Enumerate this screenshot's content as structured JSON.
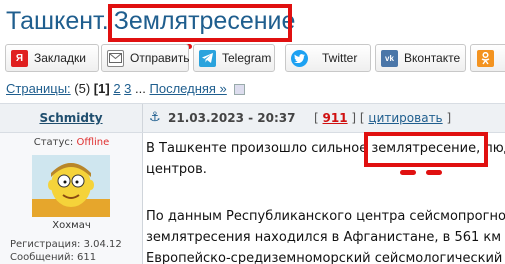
{
  "title": {
    "city": "Ташкент.",
    "topic": "Землятресение"
  },
  "share": {
    "buttons": [
      {
        "label": "Закладки",
        "icon": "yandex-icon",
        "color": "#e02020"
      },
      {
        "label": "Отправить",
        "icon": "envelope-icon",
        "color": "#777777"
      },
      {
        "label": "Telegram",
        "icon": "telegram-icon",
        "color": "#2aa3dd"
      },
      {
        "label": "Twitter",
        "icon": "twitter-bird-icon",
        "color": "#1da1f2"
      },
      {
        "label": "Вконтакте",
        "icon": "vk-icon",
        "color": "#4a76a8"
      },
      {
        "label": "",
        "icon": "odnoklassniki-icon",
        "color": "#f39320"
      }
    ]
  },
  "pager": {
    "label": "Страницы:",
    "count": "(5)",
    "current": "[1]",
    "p2": "2",
    "p3": "3",
    "ellipsis": "...",
    "last": "Последняя »"
  },
  "post": {
    "author": "Schmidty",
    "date": "21.03.2023 - 20:37",
    "bracket_open": "[",
    "number": "911",
    "sep": "] [",
    "cite": "цитировать",
    "bracket_close": "]",
    "status_label": "Статус:",
    "status_value": "Offline",
    "rank": "Хохмач",
    "reg": "Регистрация: 3.04.12",
    "msgs": "Сообщений: 611",
    "lines": [
      "В Ташкенте произошло сильное землятресение, люд",
      "центров.",
      "По данным Республиканского центра сейсмопрогно",
      "землятресения находился в Афганистане, в 561 км",
      "Европейско-средиземноморский сейсмологический"
    ]
  },
  "colors": {
    "link": "#1f5e8e",
    "highlight": "#e01010",
    "offline": "#e03030"
  }
}
